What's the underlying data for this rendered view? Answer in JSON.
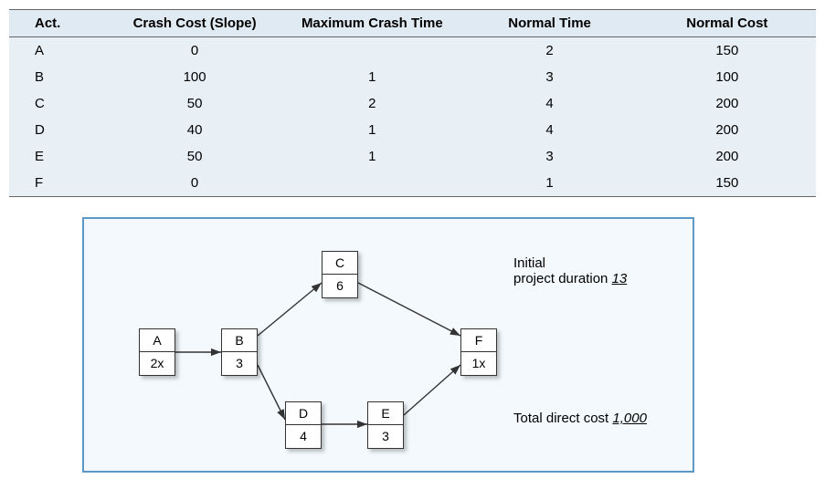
{
  "table": {
    "headers": {
      "act": "Act.",
      "crash_cost": "Crash Cost (Slope)",
      "max_crash_time": "Maximum Crash Time",
      "normal_time": "Normal Time",
      "normal_cost": "Normal Cost"
    },
    "rows": [
      {
        "act": "A",
        "crash_cost": "0",
        "max_crash_time": "",
        "normal_time": "2",
        "normal_cost": "150"
      },
      {
        "act": "B",
        "crash_cost": "100",
        "max_crash_time": "1",
        "normal_time": "3",
        "normal_cost": "100"
      },
      {
        "act": "C",
        "crash_cost": "50",
        "max_crash_time": "2",
        "normal_time": "4",
        "normal_cost": "200"
      },
      {
        "act": "D",
        "crash_cost": "40",
        "max_crash_time": "1",
        "normal_time": "4",
        "normal_cost": "200"
      },
      {
        "act": "E",
        "crash_cost": "50",
        "max_crash_time": "1",
        "normal_time": "3",
        "normal_cost": "200"
      },
      {
        "act": "F",
        "crash_cost": "0",
        "max_crash_time": "",
        "normal_time": "1",
        "normal_cost": "150"
      }
    ]
  },
  "diagram": {
    "nodes": {
      "A": {
        "label": "A",
        "value": "2x"
      },
      "B": {
        "label": "B",
        "value": "3"
      },
      "C": {
        "label": "C",
        "value": "6"
      },
      "D": {
        "label": "D",
        "value": "4"
      },
      "E": {
        "label": "E",
        "value": "3"
      },
      "F": {
        "label": "F",
        "value": "1x"
      }
    },
    "initial_label_line1": "Initial",
    "initial_label_line2_prefix": "project duration",
    "initial_duration": "13",
    "total_cost_label": "Total direct cost",
    "total_cost_value": "1,000"
  },
  "chart_data": {
    "type": "table",
    "title": "",
    "columns": [
      "Act.",
      "Crash Cost (Slope)",
      "Maximum Crash Time",
      "Normal Time",
      "Normal Cost"
    ],
    "rows": [
      [
        "A",
        0,
        null,
        2,
        150
      ],
      [
        "B",
        100,
        1,
        3,
        100
      ],
      [
        "C",
        50,
        2,
        4,
        200
      ],
      [
        "D",
        40,
        1,
        4,
        200
      ],
      [
        "E",
        50,
        1,
        3,
        200
      ],
      [
        "F",
        0,
        null,
        1,
        150
      ]
    ],
    "network": {
      "nodes": [
        {
          "id": "A",
          "duration_label": "2x"
        },
        {
          "id": "B",
          "duration_label": "3"
        },
        {
          "id": "C",
          "duration_label": "6"
        },
        {
          "id": "D",
          "duration_label": "4"
        },
        {
          "id": "E",
          "duration_label": "3"
        },
        {
          "id": "F",
          "duration_label": "1x"
        }
      ],
      "edges": [
        [
          "A",
          "B"
        ],
        [
          "B",
          "C"
        ],
        [
          "B",
          "D"
        ],
        [
          "C",
          "F"
        ],
        [
          "D",
          "E"
        ],
        [
          "E",
          "F"
        ]
      ],
      "initial_project_duration": 13,
      "total_direct_cost": 1000
    }
  }
}
